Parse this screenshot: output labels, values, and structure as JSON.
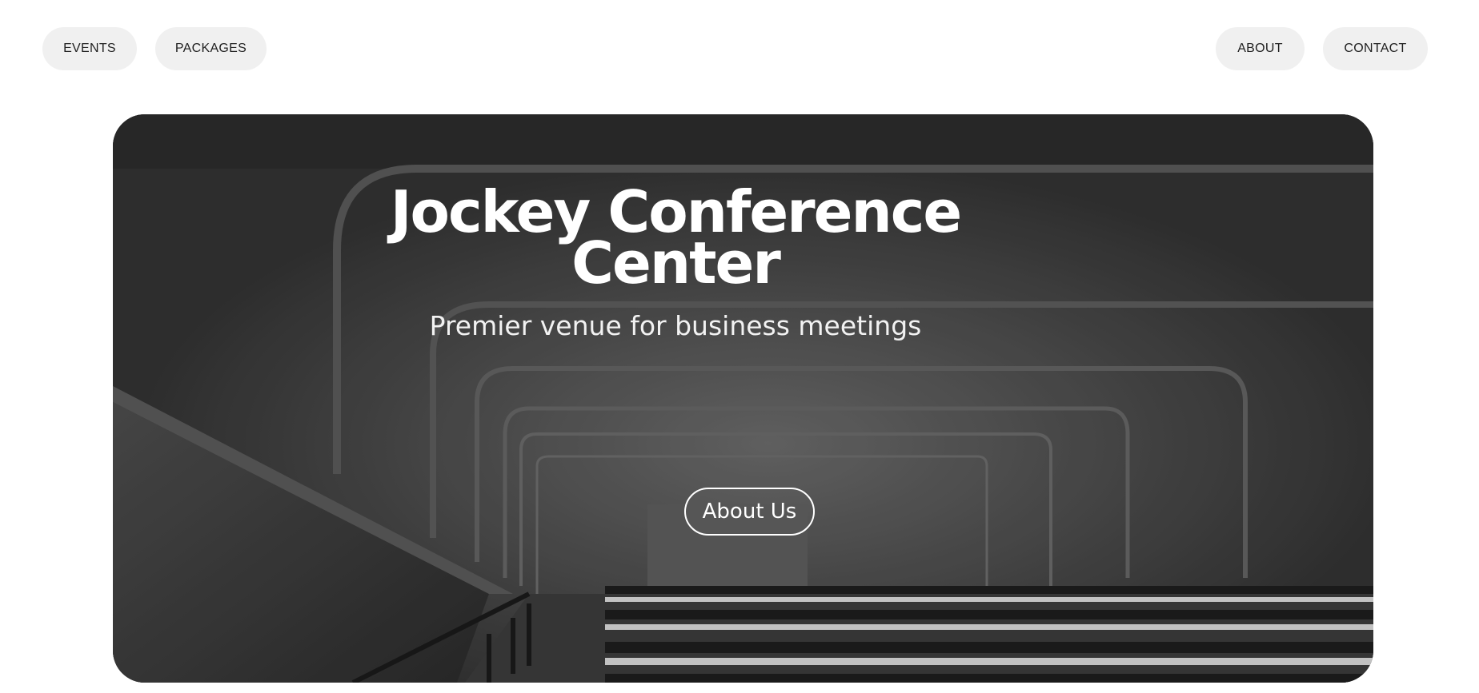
{
  "nav": {
    "events_label": "EVENTS",
    "packages_label": "PACKAGES",
    "about_label": "ABOUT",
    "contact_label": "CONTACT"
  },
  "hero": {
    "title_line1": "Jockey Conference",
    "title_line2": "Center",
    "subtitle": "Premier venue for business meetings",
    "cta_label": "About Us",
    "image": "conference-hall-photo"
  },
  "colors": {
    "background": "#ffffff",
    "nav_pill": "#f0f0f0",
    "hero_dark": "#2f2f2f",
    "hero_text": "#ffffff"
  }
}
